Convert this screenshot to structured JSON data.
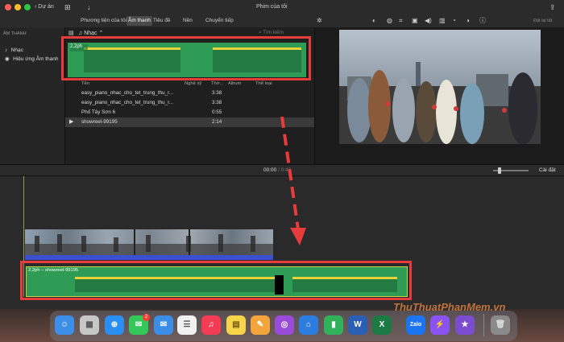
{
  "titlebar": {
    "back_label": "Dự án",
    "window_title": "Phim của tôi"
  },
  "toolbar": {
    "tabs": [
      "Phương tiện của tôi",
      "Âm thanh",
      "Tiêu đề",
      "Nền",
      "Chuyển tiếp"
    ],
    "active_tab": "Âm thanh",
    "reset_label": "Đặt lại tất"
  },
  "sidebar": {
    "section_title": "ÂM THANH",
    "items": [
      "Nhạc",
      "Hiệu ứng Âm thanh"
    ]
  },
  "browser": {
    "source_label": "Nhạc",
    "search_placeholder": "Tìm kiếm",
    "preview_duration": "2,2ph",
    "columns": [
      "Tên",
      "Nghệ sỹ",
      "Thờ...",
      "Album",
      "Thể loại"
    ],
    "rows": [
      {
        "name": "easy_piano_nhac_cho_tet_trung_thu_r...",
        "duration": "3:38"
      },
      {
        "name": "easy_piano_nhac_cho_tet_trung_thu_r...",
        "duration": "3:38"
      },
      {
        "name": "Phố Tây Sơn 6",
        "duration": "0:55"
      },
      {
        "name": "showreel-99195",
        "duration": "2:14"
      }
    ],
    "selected_row": 3
  },
  "timeline": {
    "current_time": "00:00",
    "separator": "/",
    "total_time": "0:46",
    "settings_label": "Cài đặt",
    "audio_clip_label": "2,2ph – showreel-99195"
  },
  "dock": {
    "apps": [
      {
        "icon": "finder-icon",
        "color": "#3d8ee8"
      },
      {
        "icon": "launchpad-icon",
        "color": "#c7c7c7"
      },
      {
        "icon": "safari-icon",
        "color": "#2a8ff0"
      },
      {
        "icon": "messages-icon",
        "color": "#34c759",
        "badge": "2"
      },
      {
        "icon": "mail-icon",
        "color": "#3a8ee8"
      },
      {
        "icon": "reminders-icon",
        "color": "#f2f2f2"
      },
      {
        "icon": "music-icon",
        "color": "#f33b54"
      },
      {
        "icon": "notes-icon",
        "color": "#f7d54a"
      },
      {
        "icon": "pages-icon",
        "color": "#f3a43a"
      },
      {
        "icon": "podcasts-icon",
        "color": "#9b4bd9"
      },
      {
        "icon": "keynote-icon",
        "color": "#2b7de0"
      },
      {
        "icon": "numbers-icon",
        "color": "#31b25a"
      },
      {
        "icon": "word-icon",
        "color": "#2b5fb5"
      },
      {
        "icon": "excel-icon",
        "color": "#1e7a45"
      },
      {
        "icon": "zalo-icon",
        "color": "#1d74f0",
        "text": "Zalo"
      },
      {
        "icon": "messenger-icon",
        "color": "#8a52f0"
      },
      {
        "icon": "imovie-icon",
        "color": "#7b4bd0"
      },
      {
        "icon": "trash-icon",
        "color": "#8a8a8a"
      }
    ]
  },
  "watermark": "ThuThuatPhanMem.vn",
  "colors": {
    "audio_green": "#2f9c55",
    "waveform_yellow": "#e8d23a",
    "highlight_red": "#e83b3b",
    "video_blue": "#3b4fd0"
  }
}
